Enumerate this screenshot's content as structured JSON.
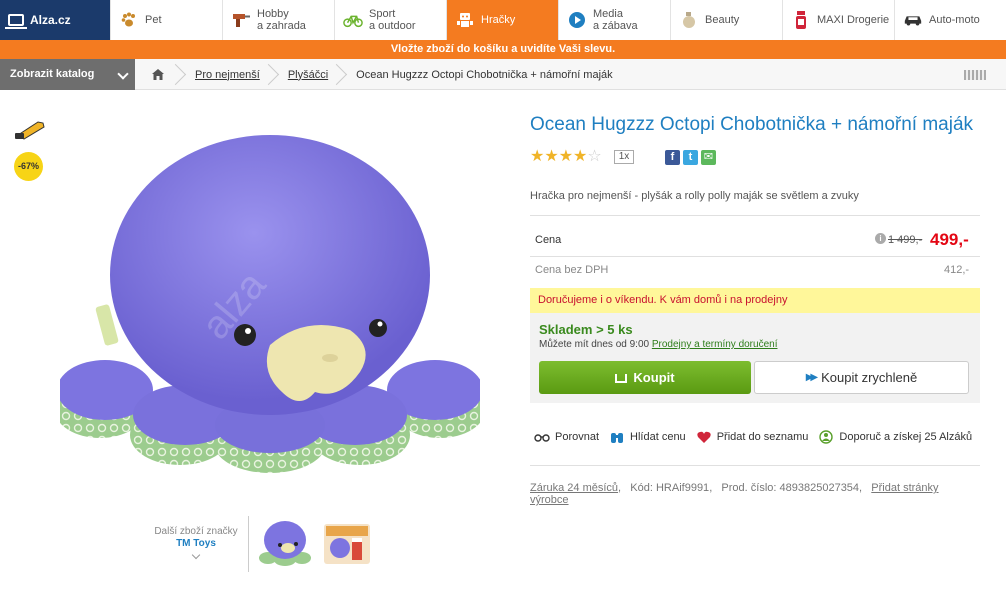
{
  "nav": {
    "logo": "Alza.cz",
    "items": [
      {
        "line1": "Pet",
        "line2": "",
        "icon": "paw-icon"
      },
      {
        "line1": "Hobby",
        "line2": "a zahrada",
        "icon": "drill-icon"
      },
      {
        "line1": "Sport",
        "line2": "a outdoor",
        "icon": "bicycle-icon"
      },
      {
        "line1": "Hračky",
        "line2": "",
        "icon": "robot-icon",
        "active": true
      },
      {
        "line1": "Media",
        "line2": "a zábava",
        "icon": "play-icon"
      },
      {
        "line1": "Beauty",
        "line2": "",
        "icon": "cream-jar-icon"
      },
      {
        "line1": "MAXI Drogerie",
        "line2": "",
        "icon": "spray-bottle-icon"
      },
      {
        "line1": "Auto-moto",
        "line2": "",
        "icon": "car-icon"
      }
    ]
  },
  "promo": "Vložte zboží do košíku a uvidíte Vaši slevu.",
  "catalog": "Zobrazit katalog",
  "breadcrumb": {
    "items": [
      "Pro nejmenší",
      "Plyšáčci"
    ],
    "current": "Ocean Hugzzz Octopi Chobotnička + námořní maják"
  },
  "badges": {
    "discount": "-67%"
  },
  "brand": {
    "label": "Další zboží značky",
    "name": "TM Toys"
  },
  "product": {
    "title": "Ocean Hugzzz Octopi Chobotnička + námořní maják",
    "rating": 4,
    "rating_max": 5,
    "review_count": "1x",
    "description": "Hračka pro nejmenší - plyšák a rolly polly maják se světlem a zvuky"
  },
  "pricing": {
    "price_label": "Cena",
    "old_price": "1 499,-",
    "price": "499,-",
    "vat_label": "Cena bez DPH",
    "vat_price": "412,-"
  },
  "delivery_note": "Doručujeme i o víkendu. K vám domů i na prodejny",
  "stock": {
    "status": "Skladem > 5 ks",
    "availability": "Můžete mít dnes od 9:00",
    "link": "Prodejny a termíny doručení"
  },
  "buttons": {
    "buy": "Koupit",
    "quick_buy": "Koupit zrychleně"
  },
  "actions": {
    "compare": "Porovnat",
    "watch": "Hlídat cenu",
    "add_list": "Přidat do seznamu",
    "recommend": "Doporuč a získej 25 Alzáků"
  },
  "meta": {
    "warranty": "Záruka 24 měsíců",
    "code_label": "Kód:",
    "code": "HRAif9991",
    "product_no_label": "Prod. číslo:",
    "product_no": "4893825027354",
    "manufacturer_link": "Přidat stránky výrobce"
  },
  "colors": {
    "brand_blue": "#1b3a6b",
    "accent_orange": "#f47b20",
    "price_red": "#e30613",
    "stock_green": "#3a8a1e",
    "title_blue": "#1f7fc1"
  }
}
